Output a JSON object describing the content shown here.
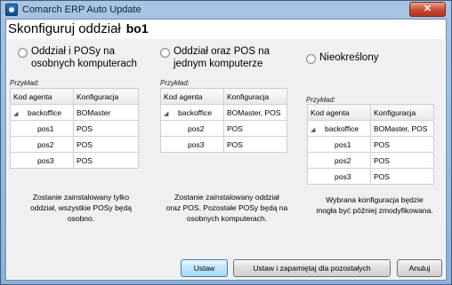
{
  "window": {
    "title": "Comarch ERP Auto Update",
    "close_label": "✕"
  },
  "heading": {
    "text": "Skonfiguruj oddział",
    "department": "bo1"
  },
  "example_label": "Przykład:",
  "table_headers": {
    "agent": "Kod agenta",
    "config": "Konfiguracja"
  },
  "options": [
    {
      "label_line1": "Oddział i POSy na",
      "label_line2": "osobnych komputerach",
      "rows": [
        {
          "agent": "backoffice",
          "config": "BOMaster",
          "root": true
        },
        {
          "agent": "pos1",
          "config": "POS"
        },
        {
          "agent": "pos2",
          "config": "POS"
        },
        {
          "agent": "pos3",
          "config": "POS"
        }
      ],
      "desc_line1": "Zostanie zainstalowany tylko",
      "desc_line2": "oddział, wszystkie POSy będą",
      "desc_line3": "osobno."
    },
    {
      "label_line1": "Oddział oraz POS na",
      "label_line2": "jednym komputerze",
      "rows": [
        {
          "agent": "backoffice",
          "config": "BOMaster, POS",
          "root": true
        },
        {
          "agent": "pos2",
          "config": "POS"
        },
        {
          "agent": "pos3",
          "config": "POS"
        }
      ],
      "desc_line1": "Zostanie zainstalowany oddział",
      "desc_line2": "oraz POS. Pozostałe POSy będą na",
      "desc_line3": "osobnych komputerach."
    },
    {
      "label_line1": "Nieokreślony",
      "label_line2": "",
      "rows": [
        {
          "agent": "backoffice",
          "config": "BOMaster, POS",
          "root": true
        },
        {
          "agent": "pos1",
          "config": "POS"
        },
        {
          "agent": "pos2",
          "config": "POS"
        },
        {
          "agent": "pos3",
          "config": "POS"
        }
      ],
      "desc_line1": "Wybrana konfiguracja będzie",
      "desc_line2": "mogła być później zmodyfikowana.",
      "desc_line3": ""
    }
  ],
  "buttons": {
    "set": "Ustaw",
    "set_remember": "Ustaw i zapamiętaj dla pozostałych",
    "cancel": "Anuluj"
  }
}
